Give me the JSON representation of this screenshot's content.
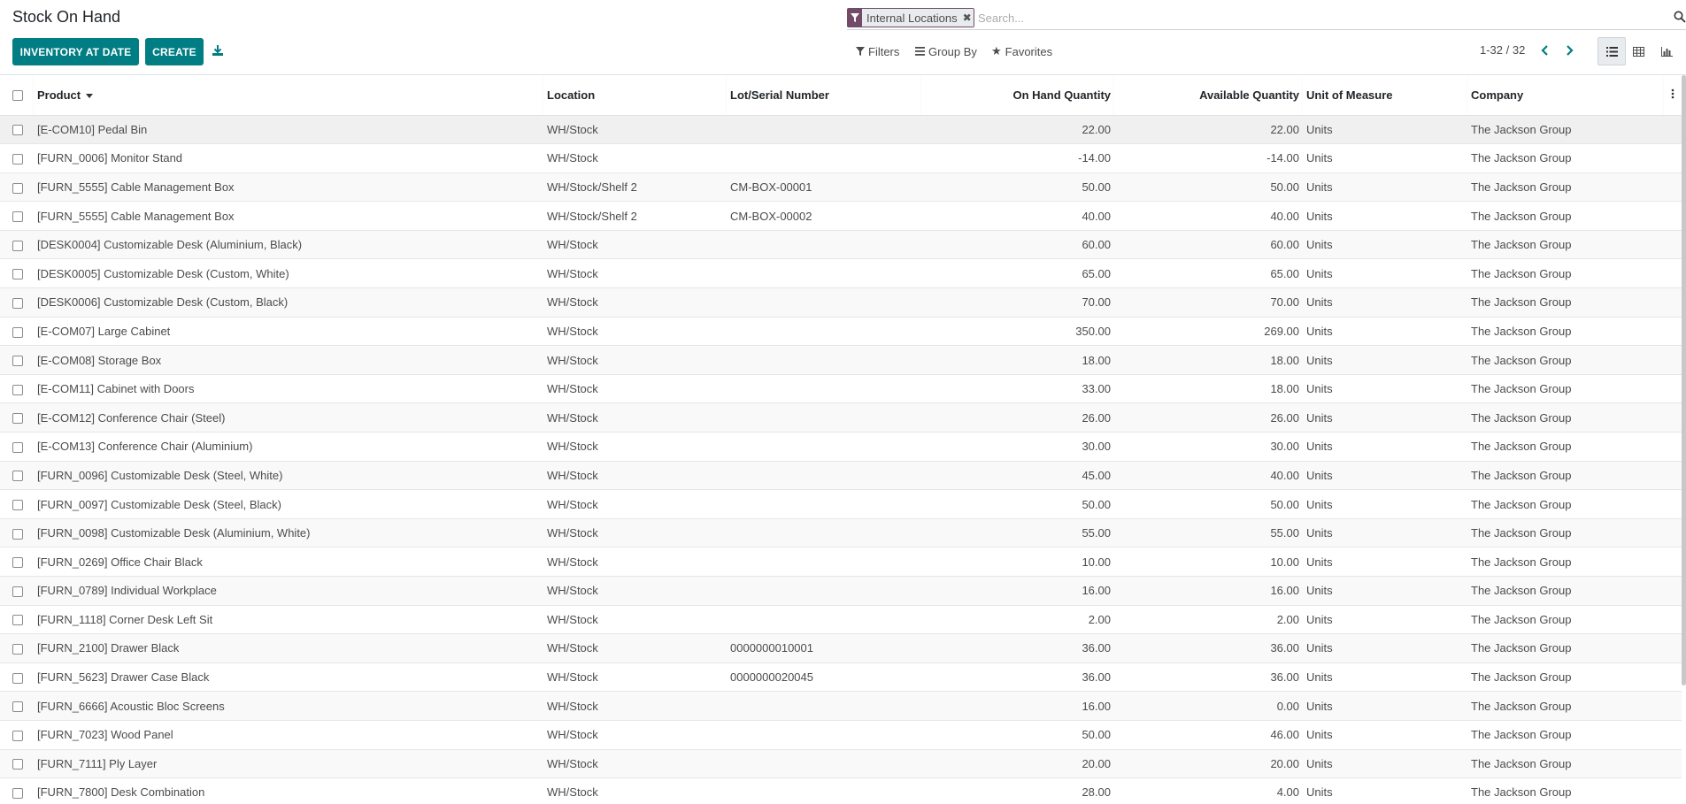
{
  "header": {
    "title": "Stock On Hand",
    "inventory_at_date_label": "INVENTORY AT DATE",
    "create_label": "CREATE"
  },
  "search": {
    "facet_value": "Internal Locations",
    "placeholder": "Search...",
    "filters_label": "Filters",
    "group_by_label": "Group By",
    "favorites_label": "Favorites"
  },
  "pager": {
    "value": "1-32 / 32"
  },
  "columns": {
    "product": "Product",
    "location": "Location",
    "lot": "Lot/Serial Number",
    "on_hand": "On Hand Quantity",
    "available": "Available Quantity",
    "uom": "Unit of Measure",
    "company": "Company"
  },
  "rows": [
    {
      "product": "[E-COM10] Pedal Bin",
      "location": "WH/Stock",
      "lot": "",
      "on_hand": "22.00",
      "available": "22.00",
      "uom": "Units",
      "company": "The Jackson Group"
    },
    {
      "product": "[FURN_0006] Monitor Stand",
      "location": "WH/Stock",
      "lot": "",
      "on_hand": "-14.00",
      "available": "-14.00",
      "uom": "Units",
      "company": "The Jackson Group"
    },
    {
      "product": "[FURN_5555] Cable Management Box",
      "location": "WH/Stock/Shelf 2",
      "lot": "CM-BOX-00001",
      "on_hand": "50.00",
      "available": "50.00",
      "uom": "Units",
      "company": "The Jackson Group"
    },
    {
      "product": "[FURN_5555] Cable Management Box",
      "location": "WH/Stock/Shelf 2",
      "lot": "CM-BOX-00002",
      "on_hand": "40.00",
      "available": "40.00",
      "uom": "Units",
      "company": "The Jackson Group"
    },
    {
      "product": "[DESK0004] Customizable Desk (Aluminium, Black)",
      "location": "WH/Stock",
      "lot": "",
      "on_hand": "60.00",
      "available": "60.00",
      "uom": "Units",
      "company": "The Jackson Group"
    },
    {
      "product": "[DESK0005] Customizable Desk (Custom, White)",
      "location": "WH/Stock",
      "lot": "",
      "on_hand": "65.00",
      "available": "65.00",
      "uom": "Units",
      "company": "The Jackson Group"
    },
    {
      "product": "[DESK0006] Customizable Desk (Custom, Black)",
      "location": "WH/Stock",
      "lot": "",
      "on_hand": "70.00",
      "available": "70.00",
      "uom": "Units",
      "company": "The Jackson Group"
    },
    {
      "product": "[E-COM07] Large Cabinet",
      "location": "WH/Stock",
      "lot": "",
      "on_hand": "350.00",
      "available": "269.00",
      "uom": "Units",
      "company": "The Jackson Group"
    },
    {
      "product": "[E-COM08] Storage Box",
      "location": "WH/Stock",
      "lot": "",
      "on_hand": "18.00",
      "available": "18.00",
      "uom": "Units",
      "company": "The Jackson Group"
    },
    {
      "product": "[E-COM11] Cabinet with Doors",
      "location": "WH/Stock",
      "lot": "",
      "on_hand": "33.00",
      "available": "18.00",
      "uom": "Units",
      "company": "The Jackson Group"
    },
    {
      "product": "[E-COM12] Conference Chair (Steel)",
      "location": "WH/Stock",
      "lot": "",
      "on_hand": "26.00",
      "available": "26.00",
      "uom": "Units",
      "company": "The Jackson Group"
    },
    {
      "product": "[E-COM13] Conference Chair (Aluminium)",
      "location": "WH/Stock",
      "lot": "",
      "on_hand": "30.00",
      "available": "30.00",
      "uom": "Units",
      "company": "The Jackson Group"
    },
    {
      "product": "[FURN_0096] Customizable Desk (Steel, White)",
      "location": "WH/Stock",
      "lot": "",
      "on_hand": "45.00",
      "available": "40.00",
      "uom": "Units",
      "company": "The Jackson Group"
    },
    {
      "product": "[FURN_0097] Customizable Desk (Steel, Black)",
      "location": "WH/Stock",
      "lot": "",
      "on_hand": "50.00",
      "available": "50.00",
      "uom": "Units",
      "company": "The Jackson Group"
    },
    {
      "product": "[FURN_0098] Customizable Desk (Aluminium, White)",
      "location": "WH/Stock",
      "lot": "",
      "on_hand": "55.00",
      "available": "55.00",
      "uom": "Units",
      "company": "The Jackson Group"
    },
    {
      "product": "[FURN_0269] Office Chair Black",
      "location": "WH/Stock",
      "lot": "",
      "on_hand": "10.00",
      "available": "10.00",
      "uom": "Units",
      "company": "The Jackson Group"
    },
    {
      "product": "[FURN_0789] Individual Workplace",
      "location": "WH/Stock",
      "lot": "",
      "on_hand": "16.00",
      "available": "16.00",
      "uom": "Units",
      "company": "The Jackson Group"
    },
    {
      "product": "[FURN_1118] Corner Desk Left Sit",
      "location": "WH/Stock",
      "lot": "",
      "on_hand": "2.00",
      "available": "2.00",
      "uom": "Units",
      "company": "The Jackson Group"
    },
    {
      "product": "[FURN_2100] Drawer Black",
      "location": "WH/Stock",
      "lot": "0000000010001",
      "on_hand": "36.00",
      "available": "36.00",
      "uom": "Units",
      "company": "The Jackson Group"
    },
    {
      "product": "[FURN_5623] Drawer Case Black",
      "location": "WH/Stock",
      "lot": "0000000020045",
      "on_hand": "36.00",
      "available": "36.00",
      "uom": "Units",
      "company": "The Jackson Group"
    },
    {
      "product": "[FURN_6666] Acoustic Bloc Screens",
      "location": "WH/Stock",
      "lot": "",
      "on_hand": "16.00",
      "available": "0.00",
      "uom": "Units",
      "company": "The Jackson Group"
    },
    {
      "product": "[FURN_7023] Wood Panel",
      "location": "WH/Stock",
      "lot": "",
      "on_hand": "50.00",
      "available": "46.00",
      "uom": "Units",
      "company": "The Jackson Group"
    },
    {
      "product": "[FURN_7111] Ply Layer",
      "location": "WH/Stock",
      "lot": "",
      "on_hand": "20.00",
      "available": "20.00",
      "uom": "Units",
      "company": "The Jackson Group"
    },
    {
      "product": "[FURN_7800] Desk Combination",
      "location": "WH/Stock",
      "lot": "",
      "on_hand": "28.00",
      "available": "4.00",
      "uom": "Units",
      "company": "The Jackson Group"
    }
  ],
  "colors": {
    "primary": "#017e84",
    "facet": "#714b67"
  },
  "icons": [
    "download-icon",
    "filter-icon",
    "search-icon",
    "bars-icon",
    "star-icon",
    "chevron-left-icon",
    "chevron-right-icon",
    "list-view-icon",
    "pivot-view-icon",
    "graph-view-icon",
    "column-options-icon"
  ]
}
